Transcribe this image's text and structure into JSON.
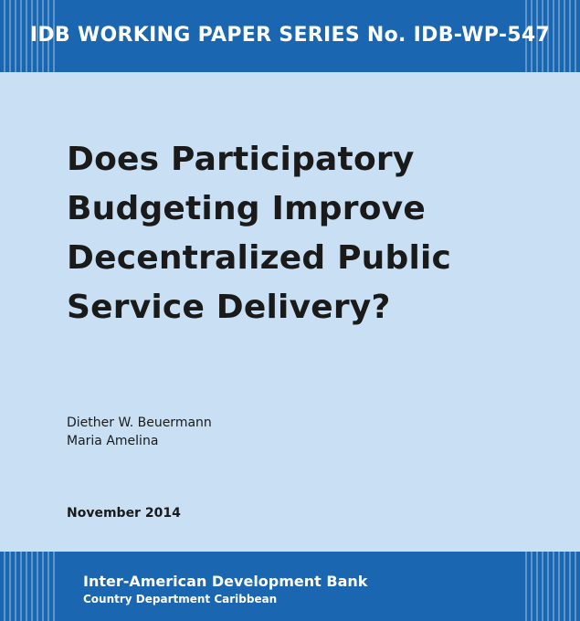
{
  "series": {
    "label": "IDB WORKING PAPER SERIES No. IDB-WP-547"
  },
  "title": {
    "lines": [
      "Does Participatory",
      "Budgeting Improve",
      "Decentralized Public",
      "Service Delivery?"
    ]
  },
  "authors": [
    "Diether W. Beuermann",
    "Maria Amelina"
  ],
  "date": "November 2014",
  "organization": {
    "name": "Inter-American Development Bank",
    "department": "Country Department Caribbean"
  },
  "colors": {
    "band_blue": "#1a66b0",
    "background_light_blue": "#c9e0f4",
    "text_dark": "#1a1a1a"
  }
}
